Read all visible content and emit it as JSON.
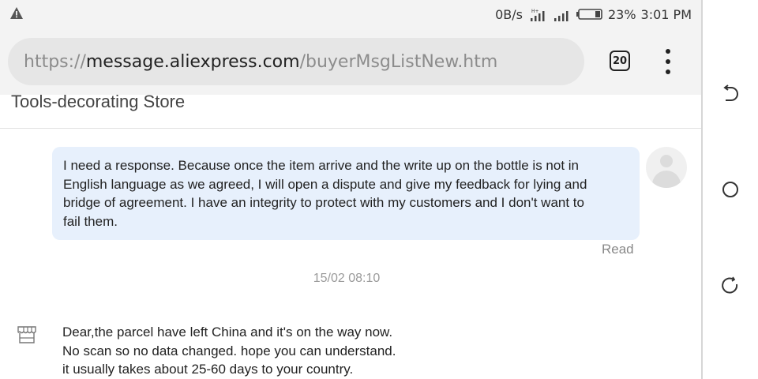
{
  "status_bar": {
    "network_speed": "0B/s",
    "battery": "23%",
    "time": "3:01 PM",
    "signal_type": "H+"
  },
  "browser": {
    "url_scheme": "https://",
    "url_host": "message.aliexpress.com",
    "url_path": "/buyerMsgListNew.htm",
    "tab_count": "20"
  },
  "chat": {
    "store_name": "Tools-decorating Store",
    "messages": [
      {
        "from": "buyer",
        "lines": [
          "I need a response. Because once the item arrive and the write up on the bottle is not in",
          "English language as we agreed, I will open a dispute and give my feedback for lying and",
          "bridge of agreement. I have an integrity to protect with my customers and I don't want to",
          "fail them."
        ],
        "status": "Read"
      },
      {
        "timestamp": "15/02 08:10"
      },
      {
        "from": "store",
        "lines": [
          "Dear,the parcel have left China and it's on the way now.",
          "No scan so no data changed. hope you can understand.",
          "it usually takes about 25-60 days to your country."
        ]
      }
    ]
  },
  "colors": {
    "bubble_bg": "#e7f0fc",
    "chrome_bg": "#f3f3f3",
    "url_box_bg": "#e6e6e6"
  },
  "icons": {
    "warning": "warning-icon",
    "signal": "signal-icon",
    "battery": "battery-icon",
    "tabs": "tab-switcher-icon",
    "menu": "more-vert-icon",
    "store": "store-icon",
    "back": "back-icon",
    "home": "home-icon",
    "recents": "recents-icon"
  }
}
